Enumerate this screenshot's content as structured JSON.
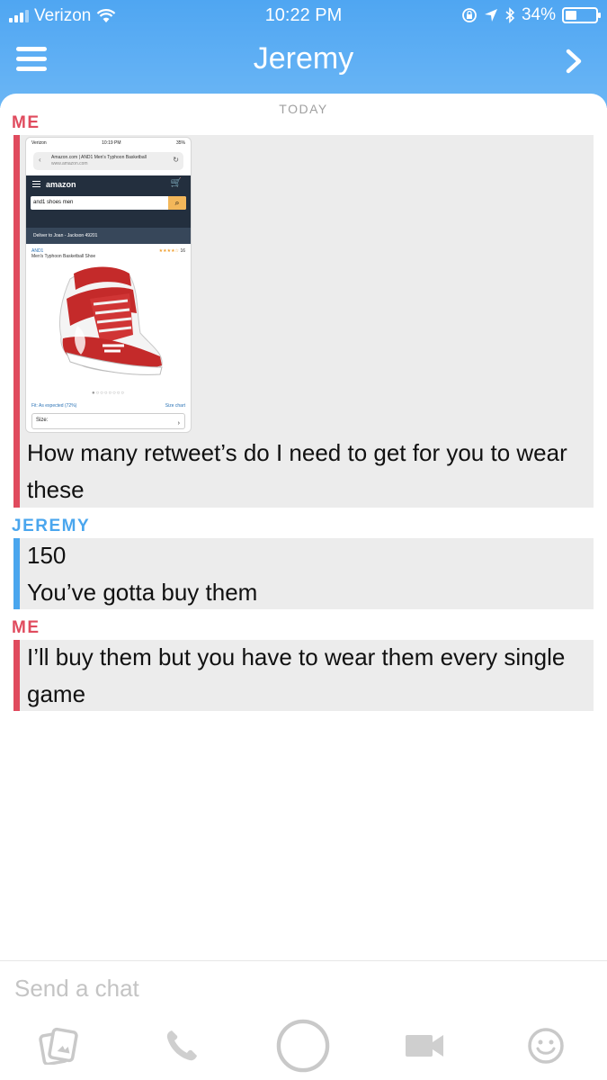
{
  "status_bar": {
    "carrier": "Verizon",
    "time": "10:22 PM",
    "battery": "34%",
    "battery_level": 0.34
  },
  "header": {
    "title": "Jeremy"
  },
  "chat": {
    "date_label": "TODAY",
    "messages": [
      {
        "sender": "ME",
        "attachment": {
          "status_carrier": "Verizon",
          "status_time": "10:19 PM",
          "status_battery": "35%",
          "url_title": "Amazon.com | AND1 Men's Typhoon Basketball",
          "url_domain": "www.amazon.com",
          "store_logo": "amazon",
          "search_query": "and1 shoes men",
          "deliver_to": "Deliver to Joan - Jackson 49201",
          "brand": "AND1",
          "rating_count": "16",
          "product_name": "Men's Typhoon Basketball Shoe",
          "fit_label": "Fit: As expected (72%)",
          "size_chart_label": "Size chart",
          "size_label": "Size:"
        },
        "text": "How many retweet’s do I need to get for you to wear these"
      },
      {
        "sender": "JEREMY",
        "lines": [
          "150",
          "You’ve gotta buy them"
        ]
      },
      {
        "sender": "ME",
        "text": "I’ll buy them but you have to wear them every single game"
      }
    ]
  },
  "composer": {
    "placeholder": "Send a chat"
  },
  "toolbar": {
    "items": [
      "memories-icon",
      "phone-icon",
      "capture-button",
      "video-icon",
      "emoji-icon"
    ]
  },
  "colors": {
    "header_blue": "#4fa6f2",
    "me_red": "#e04b5e",
    "jeremy_blue": "#4aa6ee",
    "bubble_gray": "#ececec"
  }
}
